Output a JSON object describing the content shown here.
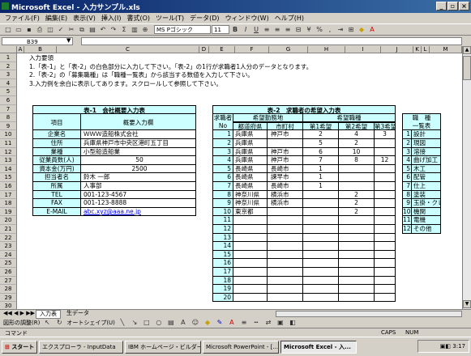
{
  "window": {
    "title": "Microsoft Excel - 入力サンプル.xls"
  },
  "menu": [
    "ファイル(F)",
    "編集(E)",
    "表示(V)",
    "挿入(I)",
    "書式(O)",
    "ツール(T)",
    "データ(D)",
    "ウィンドウ(W)",
    "ヘルプ(H)"
  ],
  "toolbar": {
    "font_name": "MS Pゴシック",
    "font_size": "11"
  },
  "namebox": "B39",
  "columns": [
    "A",
    "B",
    "C",
    "D",
    "E",
    "F",
    "G",
    "H",
    "I",
    "J",
    "K",
    "L",
    "M"
  ],
  "instructions": {
    "heading": "入力要領",
    "line1": "1.「表-1」と「表-2」の白色部分に入力して下さい。「表-2」の1行が求職者1人分のデータとなります。",
    "line2": "2.「表-2」の「募集職種」は「職種一覧表」から該当する数値を入力して下さい。",
    "line3": "3.入力例を余白に表示してあります。スクロールして参照して下さい。"
  },
  "table1": {
    "title": "表-1　会社概要入力表",
    "hdr_item": "項目",
    "hdr_value": "概要入力欄",
    "rows": [
      {
        "label": "企業名",
        "value": "ＷＷＷ造船株式会社"
      },
      {
        "label": "住所",
        "value": "兵庫県神戸市中央区港町五丁目"
      },
      {
        "label": "業種",
        "value": "小型船造船業"
      },
      {
        "label": "従業員数(人)",
        "value": "50"
      },
      {
        "label": "資本金(万円)",
        "value": "2500"
      },
      {
        "label": "担当者名",
        "value": "鈴木 一郎"
      },
      {
        "label": "所属",
        "value": "人事部"
      },
      {
        "label": "TEL",
        "value": "001-123-4567"
      },
      {
        "label": "FAX",
        "value": "001-123-8888"
      },
      {
        "label": "E-MAIL",
        "value": "abc.xyz@aaa.ne.jp"
      }
    ]
  },
  "table2": {
    "title": "表-2　求職者の希望入力表",
    "hdr_no": "求職者No",
    "hdr_loc": "希望勤務地",
    "hdr_pref": "都道府県",
    "hdr_city": "市町村",
    "hdr_job": "希望職種",
    "hdr_j1": "第1希望",
    "hdr_j2": "第2希望",
    "hdr_j3": "第3希望",
    "rows": [
      {
        "no": "1",
        "pref": "兵庫県",
        "city": "神戸市",
        "j1": "2",
        "j2": "4",
        "j3": "3"
      },
      {
        "no": "2",
        "pref": "兵庫県",
        "city": "",
        "j1": "5",
        "j2": "2",
        "j3": ""
      },
      {
        "no": "3",
        "pref": "兵庫県",
        "city": "神戸市",
        "j1": "6",
        "j2": "10",
        "j3": ""
      },
      {
        "no": "4",
        "pref": "兵庫県",
        "city": "神戸市",
        "j1": "7",
        "j2": "8",
        "j3": "12"
      },
      {
        "no": "5",
        "pref": "長崎県",
        "city": "長崎市",
        "j1": "1",
        "j2": "",
        "j3": ""
      },
      {
        "no": "6",
        "pref": "長崎県",
        "city": "諫早市",
        "j1": "1",
        "j2": "",
        "j3": ""
      },
      {
        "no": "7",
        "pref": "長崎県",
        "city": "長崎市",
        "j1": "1",
        "j2": "",
        "j3": ""
      },
      {
        "no": "8",
        "pref": "神奈川県",
        "city": "横浜市",
        "j1": "",
        "j2": "2",
        "j3": ""
      },
      {
        "no": "9",
        "pref": "神奈川県",
        "city": "横浜市",
        "j1": "",
        "j2": "2",
        "j3": ""
      },
      {
        "no": "10",
        "pref": "東京都",
        "city": "",
        "j1": "",
        "j2": "2",
        "j3": ""
      },
      {
        "no": "11",
        "pref": "",
        "city": "",
        "j1": "",
        "j2": "",
        "j3": ""
      },
      {
        "no": "12",
        "pref": "",
        "city": "",
        "j1": "",
        "j2": "",
        "j3": ""
      },
      {
        "no": "13",
        "pref": "",
        "city": "",
        "j1": "",
        "j2": "",
        "j3": ""
      },
      {
        "no": "14",
        "pref": "",
        "city": "",
        "j1": "",
        "j2": "",
        "j3": ""
      },
      {
        "no": "15",
        "pref": "",
        "city": "",
        "j1": "",
        "j2": "",
        "j3": ""
      },
      {
        "no": "16",
        "pref": "",
        "city": "",
        "j1": "",
        "j2": "",
        "j3": ""
      },
      {
        "no": "17",
        "pref": "",
        "city": "",
        "j1": "",
        "j2": "",
        "j3": ""
      },
      {
        "no": "18",
        "pref": "",
        "city": "",
        "j1": "",
        "j2": "",
        "j3": ""
      },
      {
        "no": "19",
        "pref": "",
        "city": "",
        "j1": "",
        "j2": "",
        "j3": ""
      },
      {
        "no": "20",
        "pref": "",
        "city": "",
        "j1": "",
        "j2": "",
        "j3": ""
      }
    ]
  },
  "jobs": {
    "title1": "職　種",
    "title2": "一覧表",
    "items": [
      {
        "no": "1",
        "name": "設計"
      },
      {
        "no": "2",
        "name": "現図"
      },
      {
        "no": "3",
        "name": "溶接"
      },
      {
        "no": "4",
        "name": "曲げ加工"
      },
      {
        "no": "5",
        "name": "木工"
      },
      {
        "no": "6",
        "name": "配管"
      },
      {
        "no": "7",
        "name": "仕上"
      },
      {
        "no": "8",
        "name": "塗装"
      },
      {
        "no": "9",
        "name": "玉掛・クレーン"
      },
      {
        "no": "10",
        "name": "機関"
      },
      {
        "no": "11",
        "name": "電機"
      },
      {
        "no": "12",
        "name": "その他"
      }
    ]
  },
  "sheet_tabs": [
    "入力表",
    "生データ"
  ],
  "drawbar": {
    "draw": "図形の調整(R)",
    "autoshape": "オートシェイプ(U)"
  },
  "status": {
    "left": "コマンド",
    "caps": "CAPS",
    "num": "NUM"
  },
  "taskbar": {
    "start": "スタート",
    "tasks": [
      "エクスプローラ - InputData",
      "IBM ホームページ・ビルダー...",
      "Microsoft PowerPoint - [...",
      "Microsoft Excel - 入..."
    ],
    "clock": "3:17"
  },
  "colors": {
    "header_fill": "#ccffff",
    "title_blue": "#0a246a"
  }
}
